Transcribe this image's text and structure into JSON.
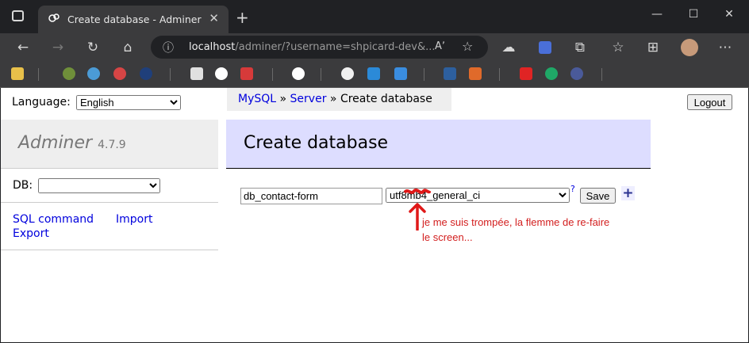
{
  "browser": {
    "tab_title": "Create database - Adminer",
    "url_host": "localhost",
    "url_path": "/adminer/?username=shpicard-dev&...",
    "nav_icons": [
      "back-icon",
      "forward-icon",
      "refresh-icon",
      "home-icon",
      "info-icon"
    ],
    "window_buttons": [
      "minimize-icon",
      "maximize-icon",
      "close-icon"
    ]
  },
  "page": {
    "language_label": "Language:",
    "language_value": "English",
    "breadcrumb": {
      "mysql": "MySQL",
      "sep1": " » ",
      "server": "Server",
      "sep2": " » ",
      "current": "Create database"
    },
    "logout_label": "Logout",
    "brand": {
      "name": "Adminer",
      "version": "4.7.9"
    },
    "db_label": "DB:",
    "db_value": "",
    "links": {
      "sql_command": "SQL command",
      "import": "Import",
      "export": "Export"
    },
    "heading": "Create database",
    "form": {
      "db_name": "db_contact-form",
      "collation": "utf8mb4_general_ci",
      "help": "?",
      "save_label": "Save",
      "plus_label": "+"
    },
    "annotation": "je me suis trompée, la flemme de re-faire le screen...",
    "colors": {
      "link": "#0000dd",
      "heading_bg": "#ddddff",
      "annotation": "#d32020"
    }
  }
}
